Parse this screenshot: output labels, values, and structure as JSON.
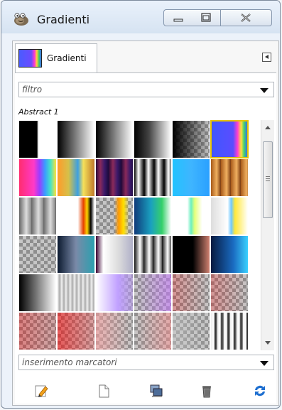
{
  "window": {
    "title": "Gradienti",
    "controls": [
      "minimize",
      "maximize",
      "close"
    ]
  },
  "tab": {
    "label": "Gradienti",
    "menu_icon": "tab-menu-icon"
  },
  "filter": {
    "placeholder": "filtro"
  },
  "active_gradient": {
    "name": "Abstract 1"
  },
  "gradients": {
    "rows": 6,
    "columns": 6,
    "selected_index": 5,
    "items": [
      {
        "index": 0
      },
      {
        "index": 1
      },
      {
        "index": 2
      },
      {
        "index": 3
      },
      {
        "index": 4
      },
      {
        "index": 5
      },
      {
        "index": 6
      },
      {
        "index": 7
      },
      {
        "index": 8
      },
      {
        "index": 9
      },
      {
        "index": 10
      },
      {
        "index": 11
      },
      {
        "index": 12
      },
      {
        "index": 13
      },
      {
        "index": 14
      },
      {
        "index": 15
      },
      {
        "index": 16
      },
      {
        "index": 17
      },
      {
        "index": 18
      },
      {
        "index": 19
      },
      {
        "index": 20
      },
      {
        "index": 21
      },
      {
        "index": 22
      },
      {
        "index": 23
      },
      {
        "index": 24
      },
      {
        "index": 25
      },
      {
        "index": 26
      },
      {
        "index": 27
      },
      {
        "index": 28
      },
      {
        "index": 29
      },
      {
        "index": 30
      },
      {
        "index": 31
      },
      {
        "index": 32
      },
      {
        "index": 33
      },
      {
        "index": 34
      },
      {
        "index": 35
      }
    ]
  },
  "tag_entry": {
    "placeholder": "inserimento marcatori"
  },
  "toolbar": {
    "buttons": [
      {
        "icon": "edit-icon"
      },
      {
        "icon": "new-document-icon"
      },
      {
        "icon": "duplicate-icon"
      },
      {
        "icon": "trash-icon"
      },
      {
        "icon": "refresh-icon"
      }
    ]
  },
  "colors": {
    "selection_outline": "#e6c200",
    "window_frame": "#7c8a9c",
    "refresh_blue": "#1e6fd0"
  }
}
